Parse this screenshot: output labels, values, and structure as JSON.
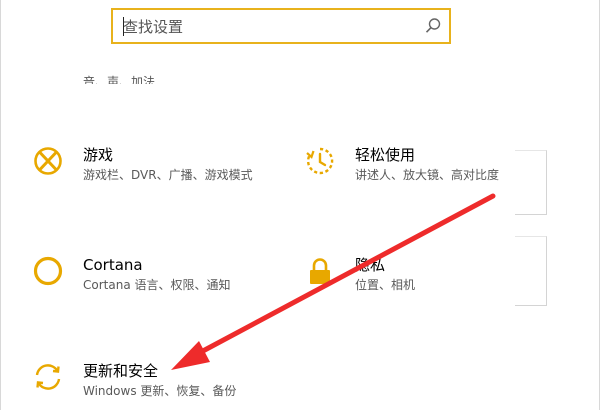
{
  "search": {
    "placeholder": "查找设置",
    "icon": "search-icon"
  },
  "clipped_row": {
    "text": "音、声、加法"
  },
  "tiles": [
    {
      "title": "游戏",
      "desc": "游戏栏、DVR、广播、游戏模式",
      "icon": "xbox-icon"
    },
    {
      "title": "轻松使用",
      "desc": "讲述人、放大镜、高对比度",
      "icon": "ease-of-access-icon"
    },
    {
      "title": "Cortana",
      "desc": "Cortana 语言、权限、通知",
      "icon": "cortana-icon"
    },
    {
      "title": "隐私",
      "desc": "位置、相机",
      "icon": "lock-icon"
    },
    {
      "title": "更新和安全",
      "desc": "Windows 更新、恢复、备份",
      "icon": "sync-icon"
    }
  ],
  "colors": {
    "accent": "#e8a800",
    "search_border": "#e8b21c",
    "arrow": "#ee2b2b"
  }
}
